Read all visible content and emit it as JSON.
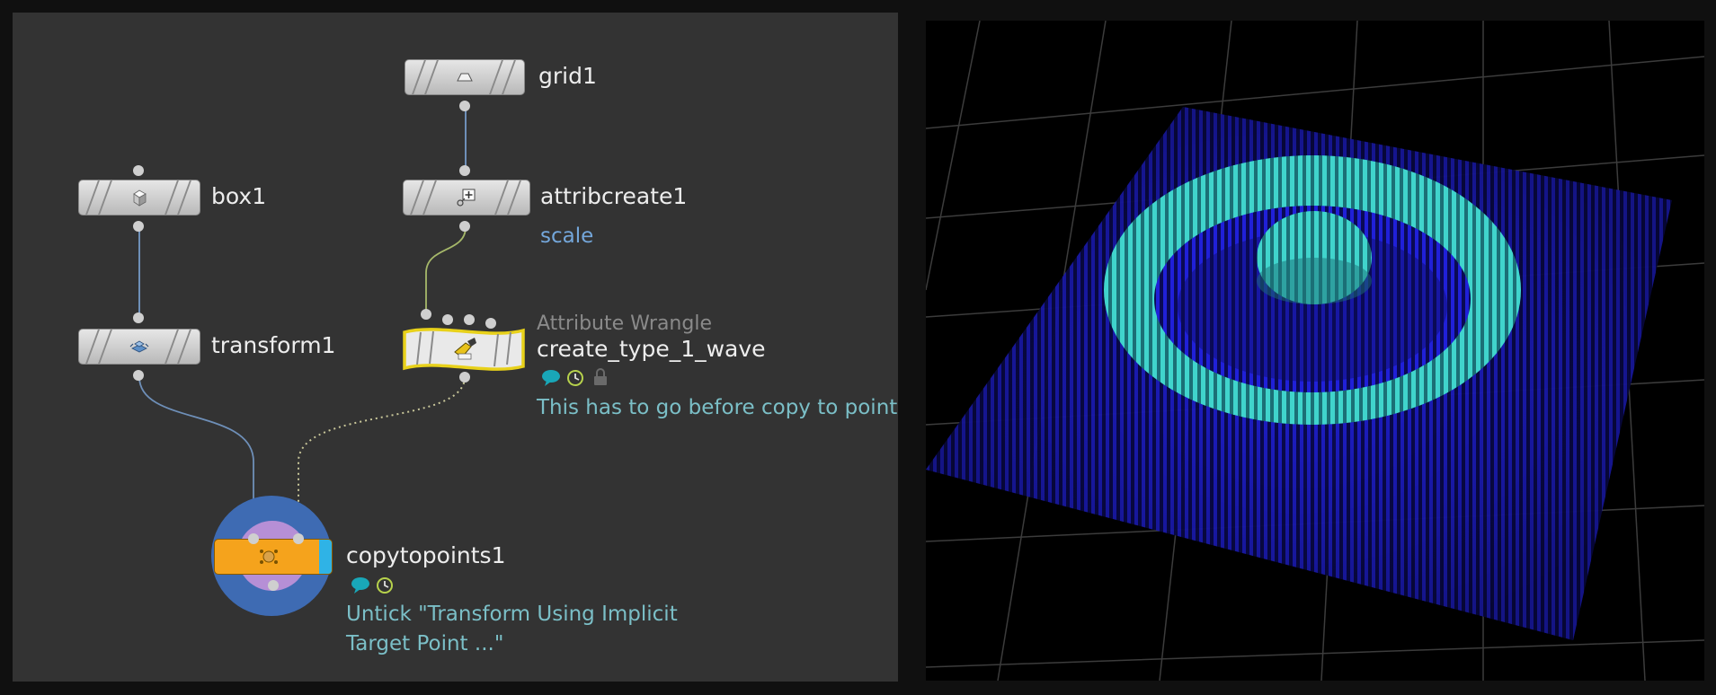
{
  "network": {
    "nodes": {
      "grid": {
        "name": "grid1",
        "icon": "grid-icon"
      },
      "box": {
        "name": "box1",
        "icon": "box-icon"
      },
      "attribcreate": {
        "name": "attribcreate1",
        "icon": "attribcreate-icon",
        "tag": "scale"
      },
      "transform": {
        "name": "transform1",
        "icon": "transform-icon"
      },
      "wrangle": {
        "type_label": "Attribute Wrangle",
        "name": "create_type_1_wave",
        "icon": "wrangle-icon",
        "comment": "This has to go before copy to points"
      },
      "copytopoints": {
        "name": "copytopoints1",
        "icon": "copytopoints-icon",
        "comment_line1": "Untick \"Transform Using Implicit",
        "comment_line2": "Target Point ...\""
      }
    },
    "colors": {
      "wire_blue": "#6e8fb8",
      "wire_green": "#a6b86a",
      "wire_dotted": "#c9c79a",
      "comment": "#7bbfc7",
      "tag_blue": "#74a7db",
      "wrangle_outline": "#e8d11a",
      "copy_orange": "#f5a31c",
      "copy_ring": "#3e6bb3",
      "copy_inner": "#b68fd6"
    }
  },
  "viewport": {
    "description_icon": "viewport-3d",
    "colors": {
      "outer": "#1a1ae0",
      "inner": "#3fd6cf",
      "grid": "#4a4a4a"
    }
  }
}
